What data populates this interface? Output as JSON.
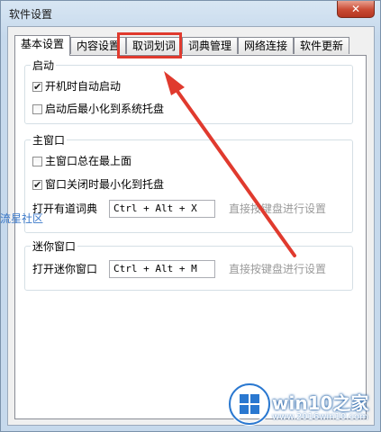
{
  "window": {
    "title": "软件设置",
    "close_glyph": "✕"
  },
  "tabs": [
    {
      "label": "基本设置",
      "active": true
    },
    {
      "label": "内容设置",
      "active": false
    },
    {
      "label": "取词划词",
      "active": false,
      "highlighted": true
    },
    {
      "label": "词典管理",
      "active": false
    },
    {
      "label": "网络连接",
      "active": false
    },
    {
      "label": "软件更新",
      "active": false
    }
  ],
  "groups": {
    "startup": {
      "title": "启动",
      "options": [
        {
          "label": "开机时自动启动",
          "checked": true
        },
        {
          "label": "启动后最小化到系统托盘",
          "checked": false
        }
      ]
    },
    "main_window": {
      "title": "主窗口",
      "options": [
        {
          "label": "主窗口总在最上面",
          "checked": false
        },
        {
          "label": "窗口关闭时最小化到托盘",
          "checked": true
        }
      ],
      "hotkey": {
        "label": "打开有道词典",
        "value": "Ctrl + Alt + X",
        "hint": "直接按键盘进行设置"
      }
    },
    "mini_window": {
      "title": "迷你窗口",
      "hotkey": {
        "label": "打开迷你窗口",
        "value": "Ctrl + Alt + M",
        "hint": "直接按键盘进行设置"
      }
    }
  },
  "watermark": {
    "left_text": "流星社区",
    "name": "win10之家",
    "url": "www.2016win10.com"
  },
  "annotation": {
    "color": "#e03a2e",
    "icon": "red-arrow-icon"
  }
}
